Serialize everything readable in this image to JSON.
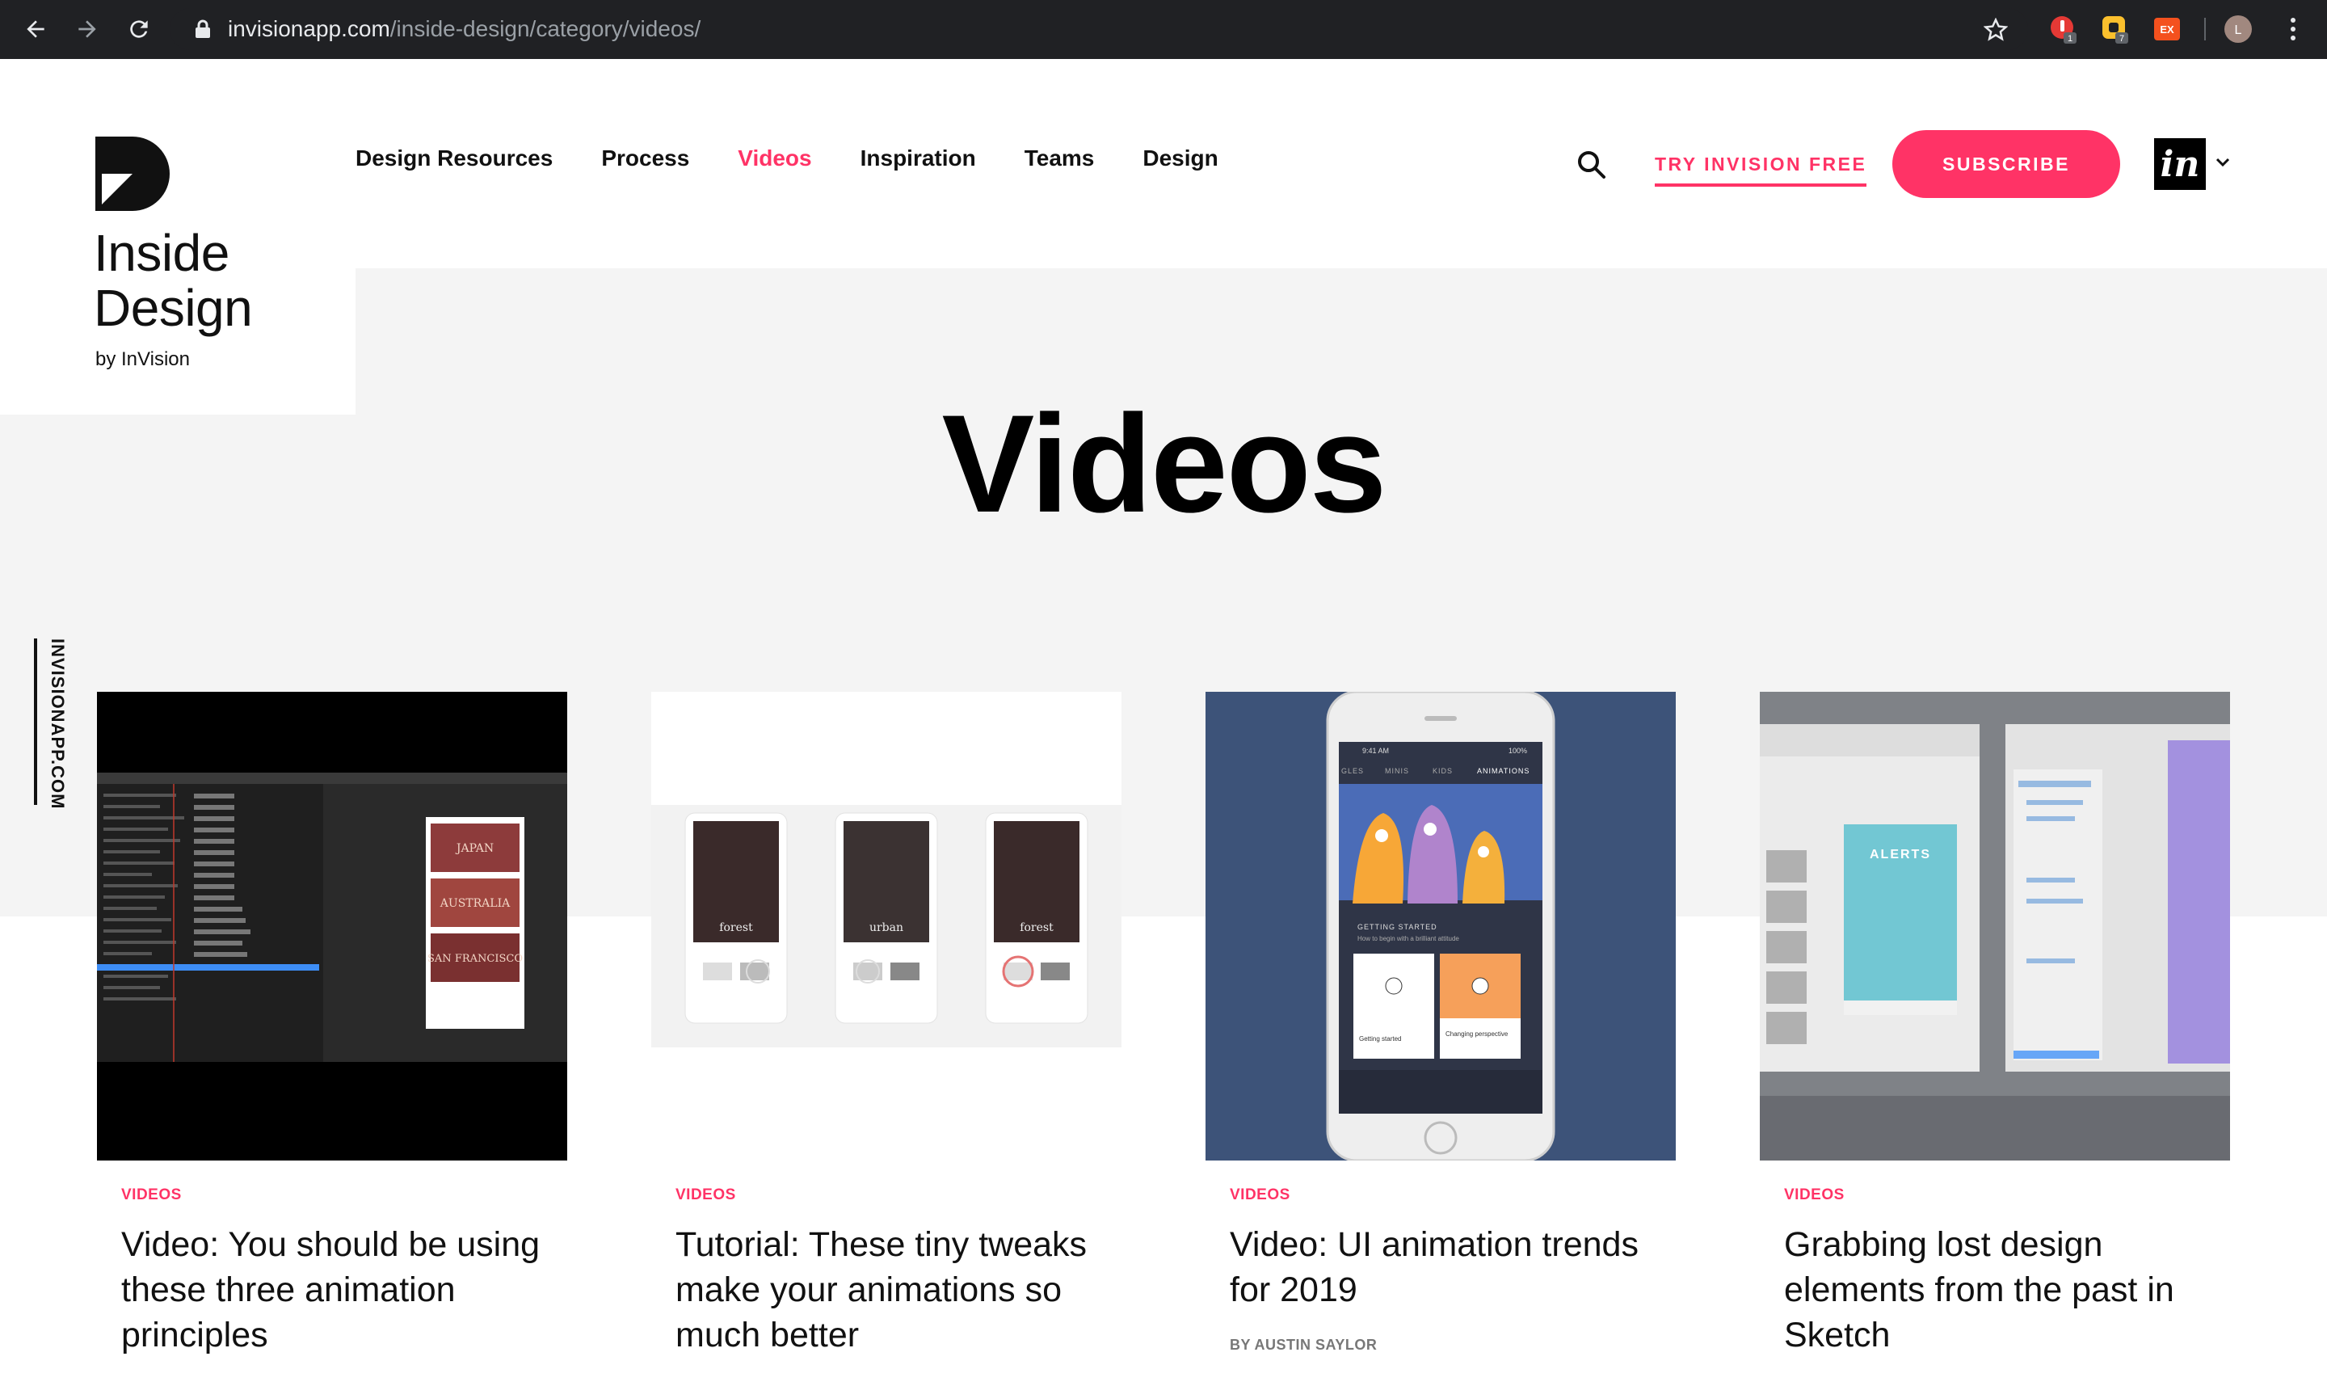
{
  "browser": {
    "url_host": "invisionapp.com",
    "url_path": "/inside-design/category/videos/",
    "ext_badges": [
      "1",
      "7"
    ],
    "ext_ex": "EX",
    "profile_initial": "L"
  },
  "brand": {
    "title_line1": "Inside",
    "title_line2": "Design",
    "byline": "by InVision",
    "side_label": "INVISIONAPP.COM"
  },
  "nav": {
    "items": [
      "Design Resources",
      "Process",
      "Videos",
      "Inspiration",
      "Teams",
      "Design"
    ],
    "active": "Videos",
    "try_label": "TRY INVISION FREE",
    "subscribe_label": "SUBSCRIBE",
    "in_logo": "in"
  },
  "page": {
    "title": "Videos"
  },
  "thumb_text": {
    "card1": [
      "JAPAN",
      "AUSTRALIA",
      "SAN FRANCISCO"
    ],
    "card2": [
      "forest",
      "urban",
      "forest"
    ],
    "card3": {
      "time": "9:41 AM",
      "battery": "100%",
      "tabs": [
        "GLES",
        "MINIS",
        "KIDS",
        "ANIMATIONS"
      ],
      "section": "GETTING STARTED",
      "section_sub": "How to begin with a brilliant attitude",
      "tiles": [
        "Getting started",
        "Changing perspective"
      ]
    },
    "card4": {
      "alerts": "ALERTS"
    }
  },
  "cards": [
    {
      "category": "VIDEOS",
      "title": "Video: You should be using these three animation principles",
      "byline": ""
    },
    {
      "category": "VIDEOS",
      "title": "Tutorial: These tiny tweaks make your animations so much better",
      "byline": ""
    },
    {
      "category": "VIDEOS",
      "title": "Video: UI animation trends for 2019",
      "byline": "BY AUSTIN SAYLOR"
    },
    {
      "category": "VIDEOS",
      "title": "Grabbing lost design elements from the past in Sketch",
      "byline": ""
    }
  ],
  "colors": {
    "accent": "#ff3366",
    "gray_band": "#f4f4f4",
    "chrome_bg": "#202124"
  }
}
